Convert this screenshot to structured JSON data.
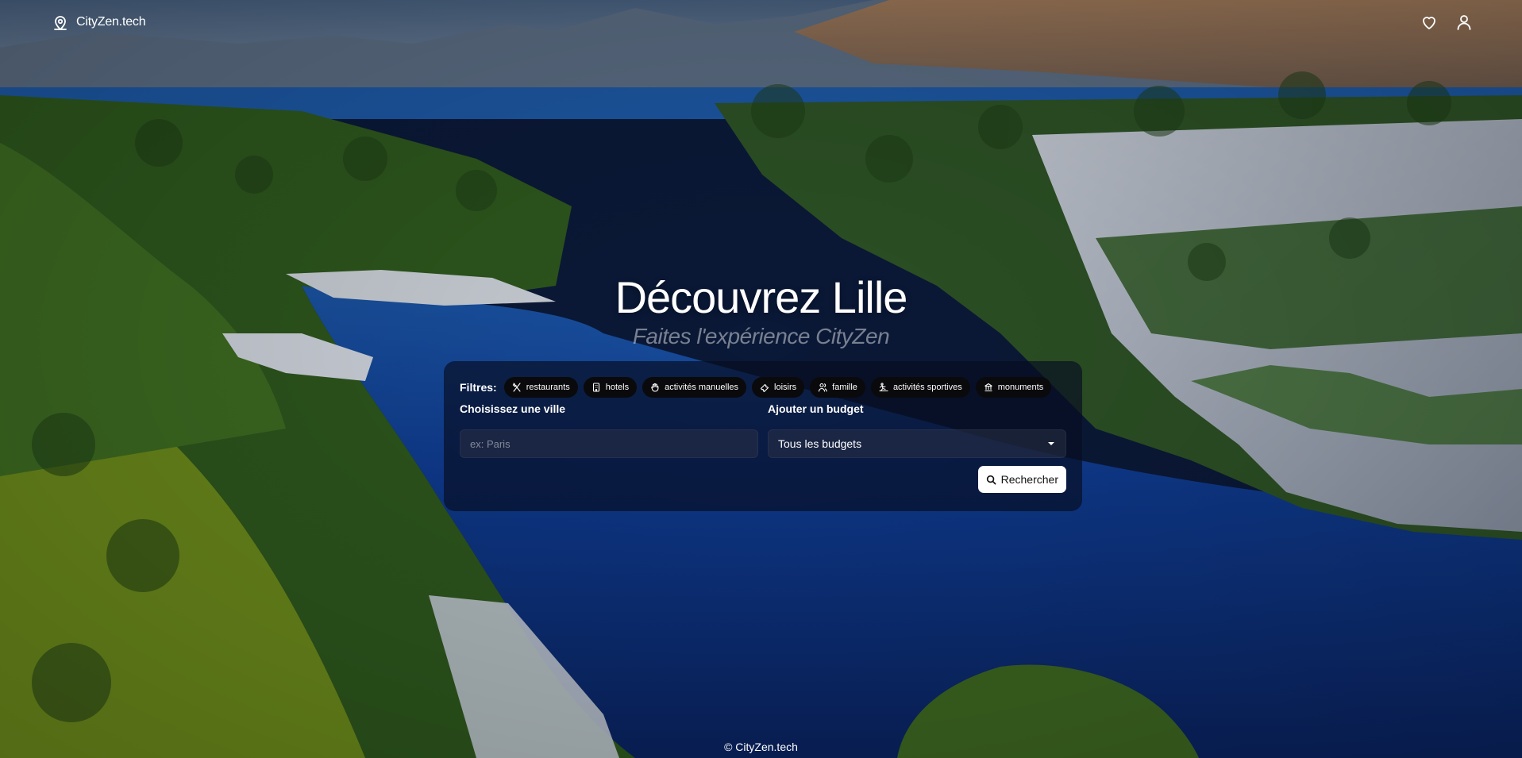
{
  "brand": {
    "name": "CityZen.tech",
    "icon": "map-pin-icon"
  },
  "header": {
    "favorites_icon": "heart-icon",
    "account_icon": "user-icon"
  },
  "hero": {
    "title": "Découvrez Lille",
    "subtitle": "Faites l'expérience CityZen"
  },
  "search": {
    "filters_label": "Filtres:",
    "filters": [
      {
        "label": "restaurants",
        "icon": "utensils-icon"
      },
      {
        "label": "hotels",
        "icon": "hotel-icon"
      },
      {
        "label": "activités manuelles",
        "icon": "hand-icon"
      },
      {
        "label": "loisirs",
        "icon": "ticket-icon"
      },
      {
        "label": "famille",
        "icon": "family-icon"
      },
      {
        "label": "activités sportives",
        "icon": "sport-icon"
      },
      {
        "label": "monuments",
        "icon": "landmark-icon"
      }
    ],
    "city_label": "Choisissez une ville",
    "city_placeholder": "ex: Paris",
    "city_value": "",
    "budget_label": "Ajouter un budget",
    "budget_selected": "Tous les budgets",
    "search_button": "Rechercher"
  },
  "footer": {
    "copyright": "© CityZen.tech"
  },
  "colors": {
    "panel_bg": "#080e22",
    "chip_bg": "#0a0a0c",
    "button_bg": "#ffffff",
    "water": "#0e2f7a"
  }
}
